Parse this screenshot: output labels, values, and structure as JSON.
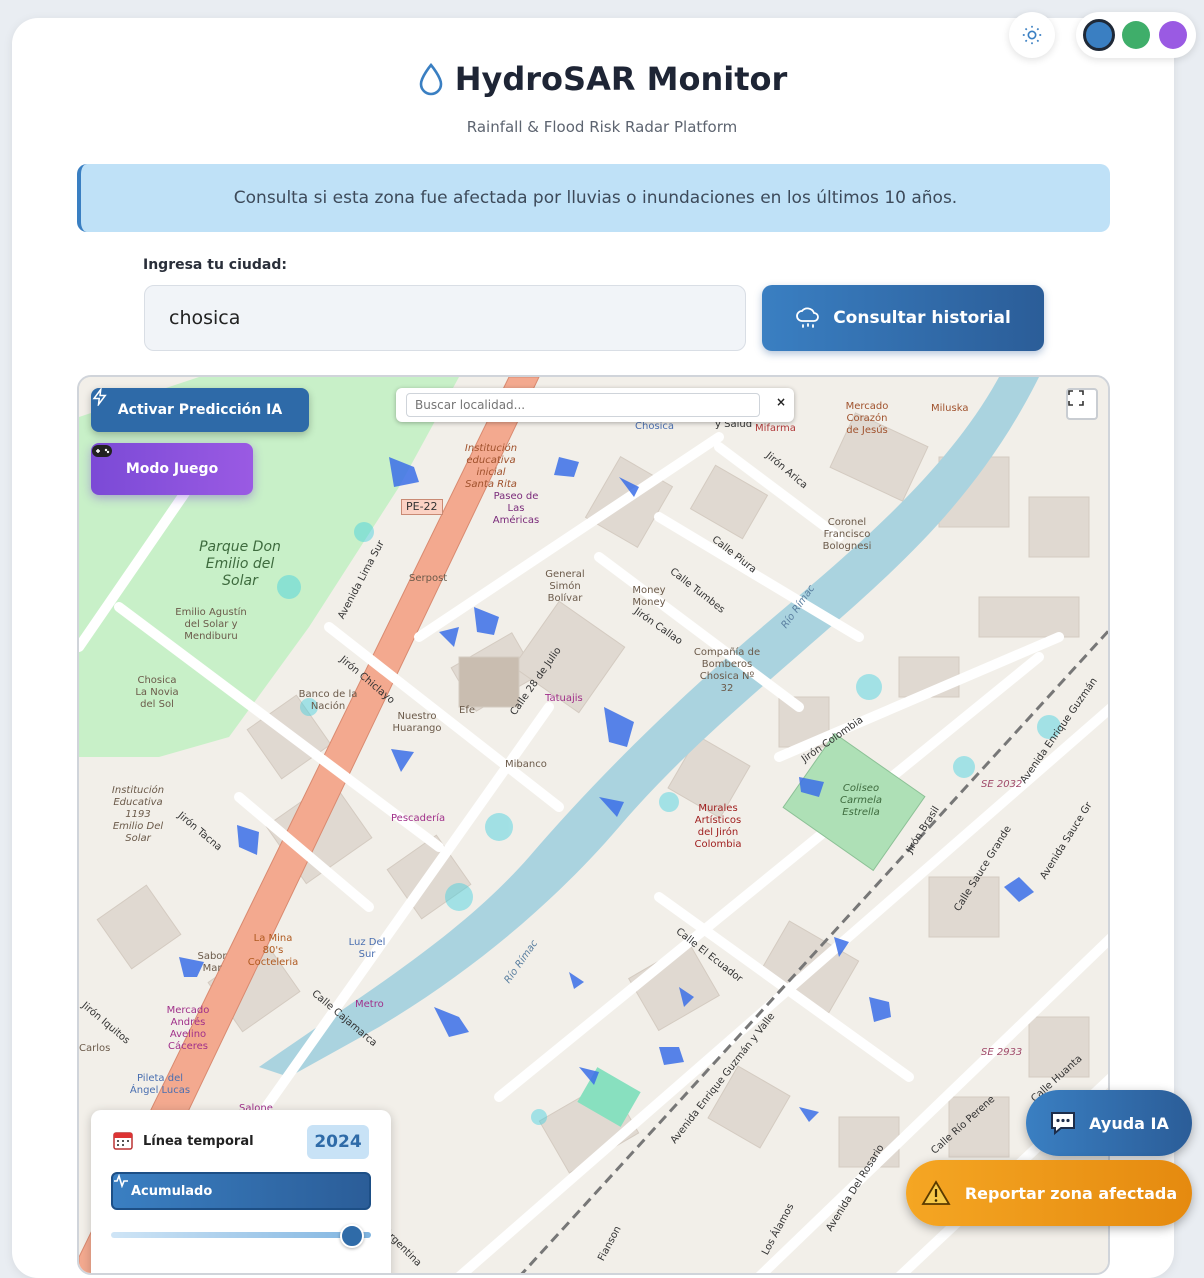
{
  "app": {
    "title": "HydroSAR Monitor",
    "subtitle": "Rainfall & Flood Risk Radar Platform"
  },
  "theme": {
    "toggle_icon": "sun-icon",
    "swatches": [
      "#3a7fc2",
      "#3fae6a",
      "#9a5ae3"
    ],
    "active_swatch": 0
  },
  "notice": {
    "text": "Consulta si esta zona fue afectada por lluvias o inundaciones en los últimos 10 años."
  },
  "search": {
    "label": "Ingresa tu ciudad:",
    "value": "chosica",
    "button_label": "Consultar historial",
    "button_icon": "cloud-rain-icon"
  },
  "map": {
    "ai_button": "Activar Predicción IA",
    "game_button": "Modo Juego",
    "locality_placeholder": "Buscar localidad...",
    "close_symbol": "×",
    "park_name": "Parque Don Emilio del Solar",
    "road_badge": "PE-22",
    "river_label": "Río Rímac",
    "stadium_label": "Coliseo Carmela Estrella",
    "labels": [
      "Chosica",
      "Mifarma",
      "Mercado Corazón de Jesús",
      "Miluska",
      "Institución educativa inicial Santa Rita",
      "Paseo de Las Américas",
      "Serpost",
      "General Simón Bolívar",
      "Money Money",
      "Compañía de Bomberos Chosica Nº 32",
      "Coronel Francisco Bolognesi",
      "Emilio Agustín del Solar y Mendiburu",
      "Chosica La Novia del Sol",
      "Banco de la Nación",
      "Nuestro Huarango",
      "Efe",
      "Tatuajis",
      "Mibanco",
      "Pescadería",
      "Murales Artísticos del Jirón Colombia",
      "Institución Educativa 1193 Emilio Del Solar",
      "La Mina 80's Cocteleria",
      "Sabor Mar",
      "Luz Del Sur",
      "Metro",
      "Mercado Andrés Avelino Cáceres",
      "Carlos",
      "Pileta del Ángel Lucas",
      "Salone"
    ],
    "streets": [
      "Avenida Lima Sur",
      "Jirón Chiclayo",
      "Calle 28 de Julio",
      "Jirón Callao",
      "Calle Tumbes",
      "Calle Piura",
      "Jirón Arica",
      "Jirón Colombia",
      "Jirón Brasil",
      "Avenida Enrique Guzmán",
      "Calle Sauce Grande",
      "Avenida Sauce Gr",
      "Calle El Ecuador",
      "Jirón Tacna",
      "Calle Cajamarca",
      "Jirón Iquitos",
      "Avenida Enrique Guzmán y Valle",
      "Avenida Del Rosario",
      "Calle Río Perene",
      "Calle Huanta",
      "Los Álamos",
      "Fianson",
      "Argentina",
      "y Salud",
      "SE 2032",
      "SE 2933"
    ]
  },
  "timeline": {
    "title": "Línea temporal",
    "year": "2024",
    "mode_label": "Acumulado",
    "slider_value": 0.92
  },
  "actions": {
    "help_label": "Ayuda IA",
    "report_label": "Reportar zona afectada"
  }
}
